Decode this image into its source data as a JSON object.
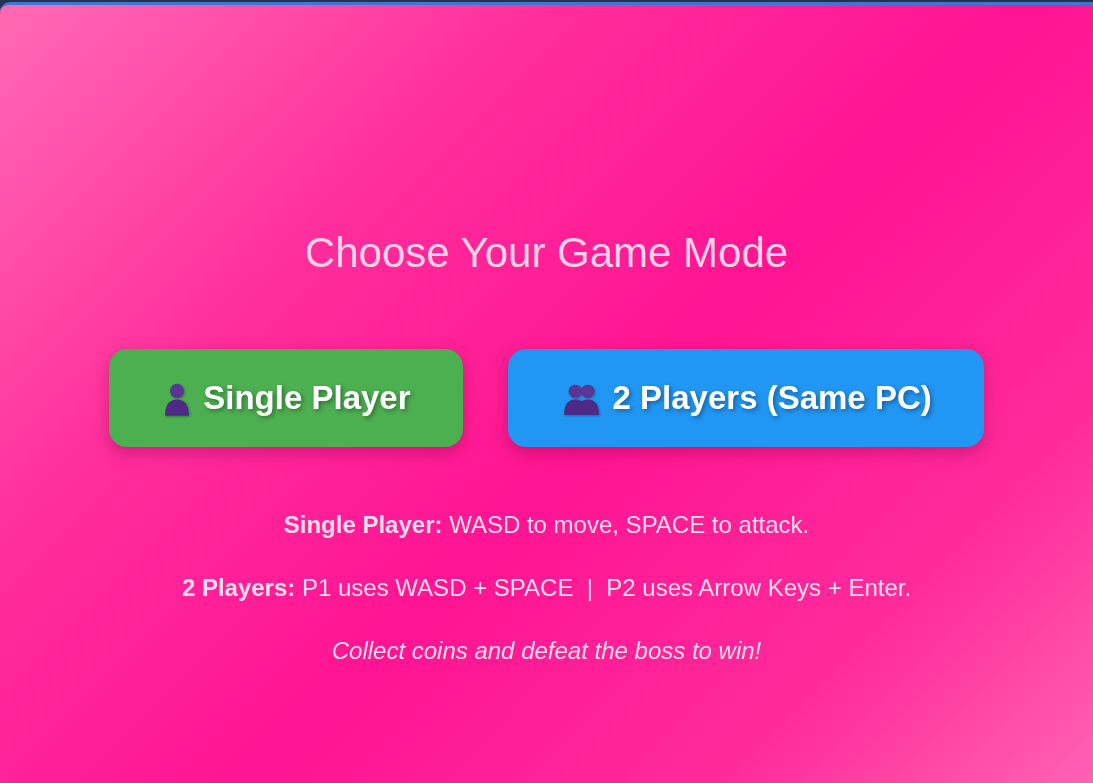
{
  "title": "Choose Your Game Mode",
  "modes": [
    {
      "kind": "single",
      "label": "Single Player",
      "color": "#4caf50"
    },
    {
      "kind": "multi",
      "label": "2 Players (Same PC)",
      "color": "#2196f3"
    }
  ],
  "instructions": [
    {
      "kind": "plain",
      "text": "**Single Player:** WASD to move, SPACE to attack."
    },
    {
      "kind": "plain",
      "text": "**2 Players:** P1 uses WASD + SPACE  |  P2 uses Arrow Keys + Enter."
    },
    {
      "kind": "tip",
      "text": "Collect coins and defeat the boss to win!"
    }
  ]
}
